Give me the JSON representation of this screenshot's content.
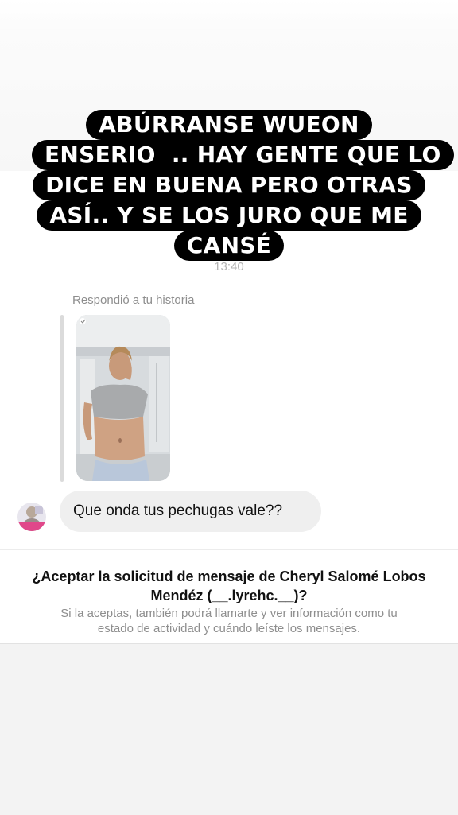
{
  "story": {
    "caption_lines": [
      "ABÚRRANSE WUEON",
      "ENSERIO  .. HAY GENTE QUE LO",
      "DICE EN BUENA PERO OTRAS",
      "ASÍ.. Y SE LOS JURO QUE ME",
      "CANSÉ"
    ]
  },
  "chat": {
    "timestamp": "13:40",
    "reply_label": "Respondió a tu historia",
    "message_text": "Que onda tus pechugas vale??"
  },
  "request": {
    "title_line1": "¿Aceptar la solicitud de mensaje de Cheryl Salomé Lobos",
    "title_line2": "Mendéz (__.lyrehc.__)?",
    "description_line1": "Si la aceptas, también podrá llamarte y ver información como tu",
    "description_line2": "estado de actividad y cuándo leíste los mensajes."
  },
  "colors": {
    "caption_background": "#000000",
    "caption_text": "#ffffff",
    "bubble_background": "#efefef",
    "secondary_text": "#8e8e8e"
  }
}
